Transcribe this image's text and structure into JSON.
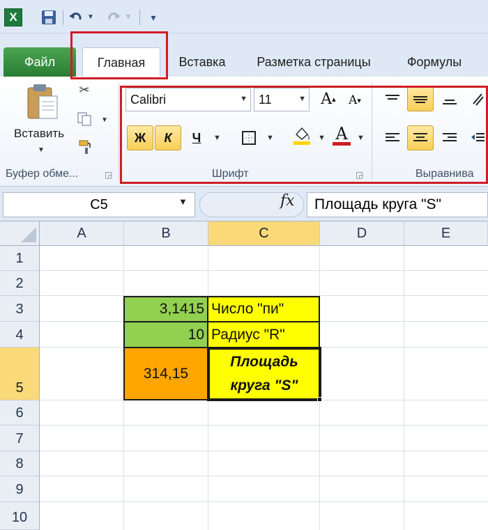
{
  "qat": {
    "logo": "X",
    "more": "▾"
  },
  "tabs": {
    "file": "Файл",
    "home": "Главная",
    "insert": "Вставка",
    "layout": "Разметка страницы",
    "formulas": "Формулы"
  },
  "ribbon": {
    "paste_label": "Вставить",
    "clipboard_label": "Буфер обме...",
    "font_group_label": "Шрифт",
    "align_group_label": "Выравнива",
    "font_name": "Calibri",
    "font_size": "11",
    "bold_label": "Ж",
    "italic_label": "К",
    "underline_label": "Ч",
    "font_color_label": "A",
    "grow_label": "A",
    "shrink_label": "A"
  },
  "formula_bar": {
    "name_box": "C5",
    "fx_label": "fx",
    "content": "Площадь круга \"S\""
  },
  "grid": {
    "columns": [
      "A",
      "B",
      "C",
      "D",
      "E"
    ],
    "rows": [
      "1",
      "2",
      "3",
      "4",
      "5",
      "6",
      "7",
      "8",
      "9",
      "10"
    ],
    "selected_column": "C",
    "selected_row": "5",
    "cells": {
      "B3": "3,1415",
      "C3": "Число \"пи\"",
      "B4": "10",
      "C4": "Радиус \"R\"",
      "B5": "314,15",
      "C5_line1": "Площадь",
      "C5_line2": "круга \"S\""
    }
  },
  "colors": {
    "green_fill": "#92d050",
    "yellow_fill": "#ffff00",
    "orange_fill": "#ffa500",
    "highlight_red": "#d01c24",
    "selection_header": "#f9d978"
  }
}
